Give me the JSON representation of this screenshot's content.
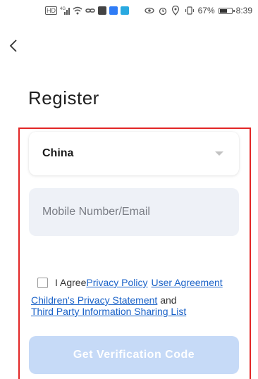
{
  "status_bar": {
    "network_label": "HD",
    "signal_label": "4G",
    "battery_percent": "67%",
    "battery_level": 0.67,
    "time": "8:39",
    "icons": [
      "hd-icon",
      "signal-icon",
      "wifi-icon",
      "link-icon",
      "app-icon",
      "app-icon",
      "app-icon",
      "eye-icon",
      "alarm-icon",
      "location-icon",
      "vibrate-icon",
      "battery-icon"
    ]
  },
  "header": {
    "back_icon": "chevron-left-icon",
    "title": "Register"
  },
  "form": {
    "country_value": "China",
    "mobile_placeholder": "Mobile Number/Email",
    "agree_text": "I Agree",
    "privacy_policy": "Privacy Policy",
    "user_agreement": "User Agreement",
    "children_privacy": "Children's Privacy Statement",
    "and_text": "and",
    "third_party": "Third Party Information Sharing List",
    "verify_button": "Get Verification Code"
  },
  "colors": {
    "outline": "#e22626",
    "link": "#1a62c8",
    "button_disabled": "#c6daf7",
    "field_background": "#eef1f7"
  }
}
